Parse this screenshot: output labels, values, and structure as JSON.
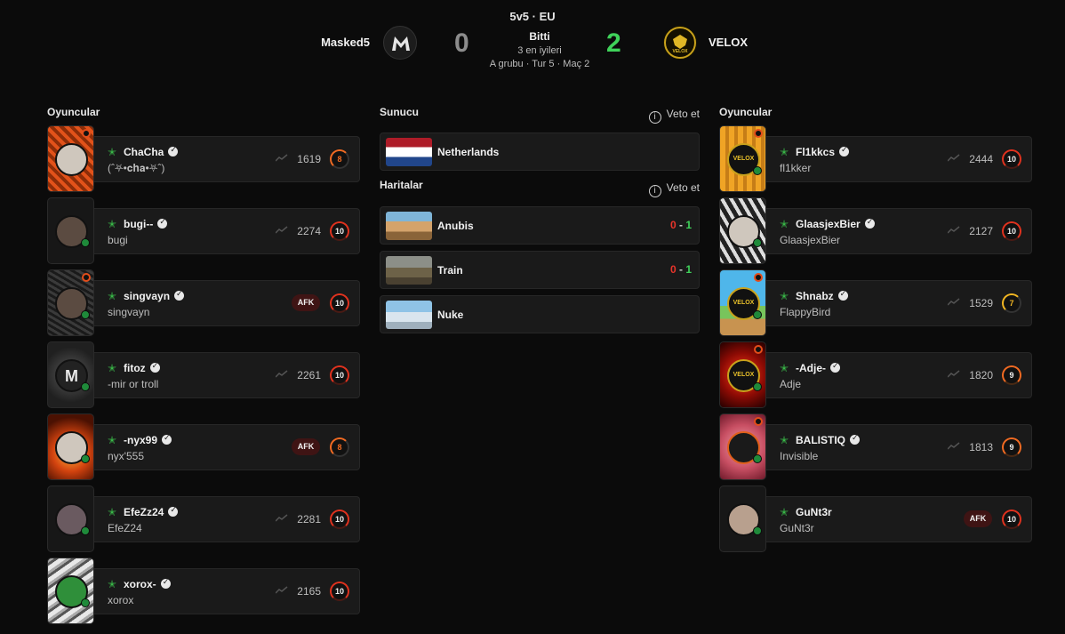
{
  "header": {
    "mode": "5v5 · EU",
    "status": "Bitti",
    "best_of": "3 en iyileri",
    "group_info": "A grubu · Tur 5 · Maç 2",
    "team1": {
      "name": "Masked5",
      "score": "0",
      "score_color": "#8c8c8c"
    },
    "team2": {
      "name": "VELOX",
      "score": "2",
      "score_color": "#3fd25a"
    }
  },
  "left_team": {
    "title": "Oyuncular",
    "players": [
      {
        "nick": "ChaCha",
        "realname": "(ˆ⛧•𝐜𝐡𝐚•⛧ˆ)",
        "elo": "1619",
        "level": "8",
        "afk": ""
      },
      {
        "nick": "bugi--",
        "realname": "bugi",
        "elo": "2274",
        "level": "10",
        "afk": ""
      },
      {
        "nick": "singvayn",
        "realname": "singvayn",
        "elo": "",
        "level": "10",
        "afk": "AFK"
      },
      {
        "nick": "fitoz",
        "realname": "-mir or troll",
        "elo": "2261",
        "level": "10",
        "afk": ""
      },
      {
        "nick": "-nyx99",
        "realname": "nyx'555",
        "elo": "",
        "level": "8",
        "afk": "AFK"
      },
      {
        "nick": "EfeZz24",
        "realname": "EfeZ24",
        "elo": "2281",
        "level": "10",
        "afk": ""
      },
      {
        "nick": "xorox-",
        "realname": "xorox",
        "elo": "2165",
        "level": "10",
        "afk": ""
      }
    ]
  },
  "right_team": {
    "title": "Oyuncular",
    "players": [
      {
        "nick": "Fl1kkcs",
        "realname": "fl1kker",
        "elo": "2444",
        "level": "10",
        "afk": ""
      },
      {
        "nick": "GlaasjexBier",
        "realname": "GlaasjexBier",
        "elo": "2127",
        "level": "10",
        "afk": ""
      },
      {
        "nick": "Shnabz",
        "realname": "FlappyBird",
        "elo": "1529",
        "level": "7",
        "afk": ""
      },
      {
        "nick": "-Adje-",
        "realname": "Adje",
        "elo": "1820",
        "level": "9",
        "afk": ""
      },
      {
        "nick": "BALISTIQ",
        "realname": "Invisible",
        "elo": "1813",
        "level": "9",
        "afk": ""
      },
      {
        "nick": "GuNt3r",
        "realname": "GuNt3r",
        "elo": "",
        "level": "10",
        "afk": "AFK"
      }
    ]
  },
  "server": {
    "title": "Sunucu",
    "veto_label": "Veto et",
    "location": "Netherlands",
    "flag_icon": "netherlands-flag-icon"
  },
  "maps": {
    "title": "Haritalar",
    "veto_label": "Veto et",
    "items": [
      {
        "name": "Anubis",
        "score_left": "0",
        "sep": " - ",
        "score_right": "1"
      },
      {
        "name": "Train",
        "score_left": "0",
        "sep": " - ",
        "score_right": "1"
      },
      {
        "name": "Nuke",
        "score_left": "",
        "sep": "",
        "score_right": ""
      }
    ]
  },
  "colors": {
    "background": "#0b0b0b",
    "card": "#1a1a1a",
    "win_green": "#3fd25a",
    "loss_red": "#e8342a",
    "level10_red": "#e0321e",
    "level_orange": "#f06a22",
    "level_yellow": "#f0b522"
  }
}
